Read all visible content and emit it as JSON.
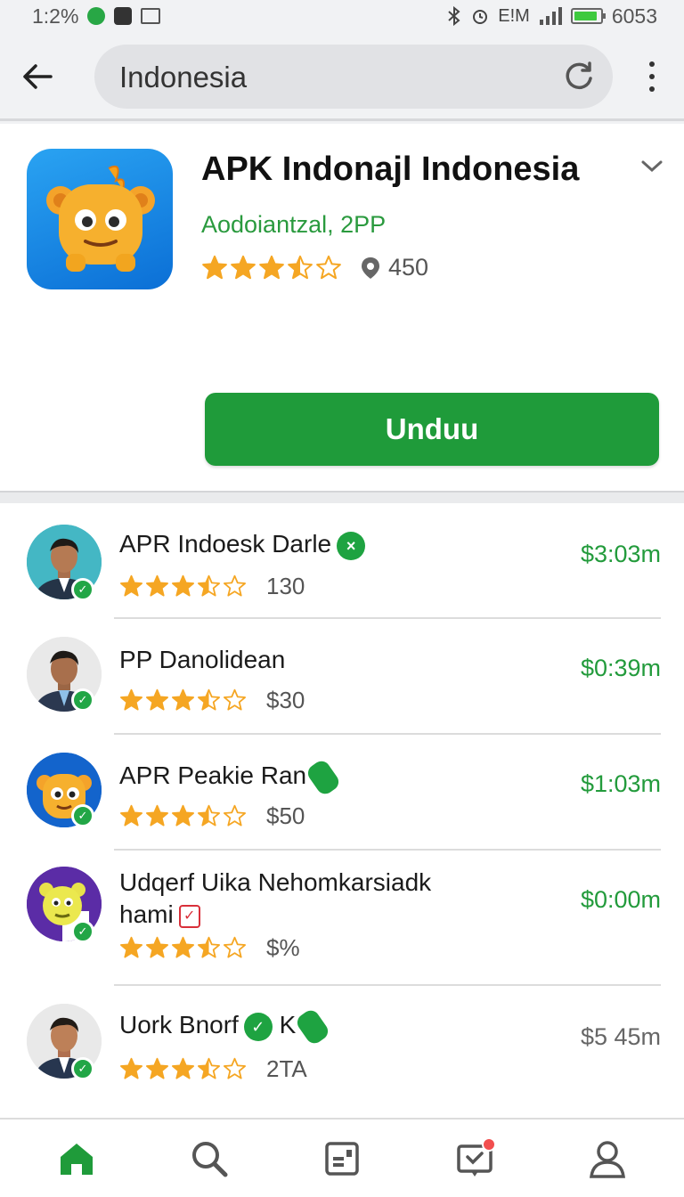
{
  "status_bar": {
    "time": "1:2%",
    "signal_text": "E!M",
    "battery": "6053",
    "battery_level": 0.9
  },
  "search": {
    "query": "Indonesia"
  },
  "app": {
    "title": "APK Indonajl Indonesia",
    "developer": "Aodoiantzal, 2PP",
    "rating": 3.5,
    "downloads": "450",
    "install_label": "Unduu"
  },
  "items": [
    {
      "name": "APR Indoesk Darle",
      "rating": 3.5,
      "meta": "130",
      "price": "$3:03m",
      "badge": "x"
    },
    {
      "name": "PP Danolidean",
      "rating": 3.5,
      "meta": "$30",
      "price": "$0:39m",
      "badge": ""
    },
    {
      "name": "APR Peakie Ran",
      "rating": 3.5,
      "meta": "$50",
      "price": "$1:03m",
      "badge": "pill"
    },
    {
      "name_line1": "Udqerf Uika Nehomkarsiadk",
      "name_line2": "hami",
      "rating": 3.5,
      "meta": "$%",
      "price": "$0:00m",
      "badge": "red"
    },
    {
      "name": "Uork Bnorf",
      "name_suffix": "K",
      "rating": 3.5,
      "meta": "2TA",
      "price": "$5 45m",
      "badge": "check"
    }
  ],
  "colors": {
    "accent_green": "#1f9b3a",
    "price_green": "#239b3c",
    "star": "#f5a623"
  },
  "icons": {
    "back": "arrow-left-icon",
    "reload": "reload-icon",
    "more": "more-vert-icon",
    "home": "home-icon",
    "search": "search-icon",
    "apps": "apps-icon",
    "updates": "inbox-check-icon",
    "account": "account-icon"
  }
}
